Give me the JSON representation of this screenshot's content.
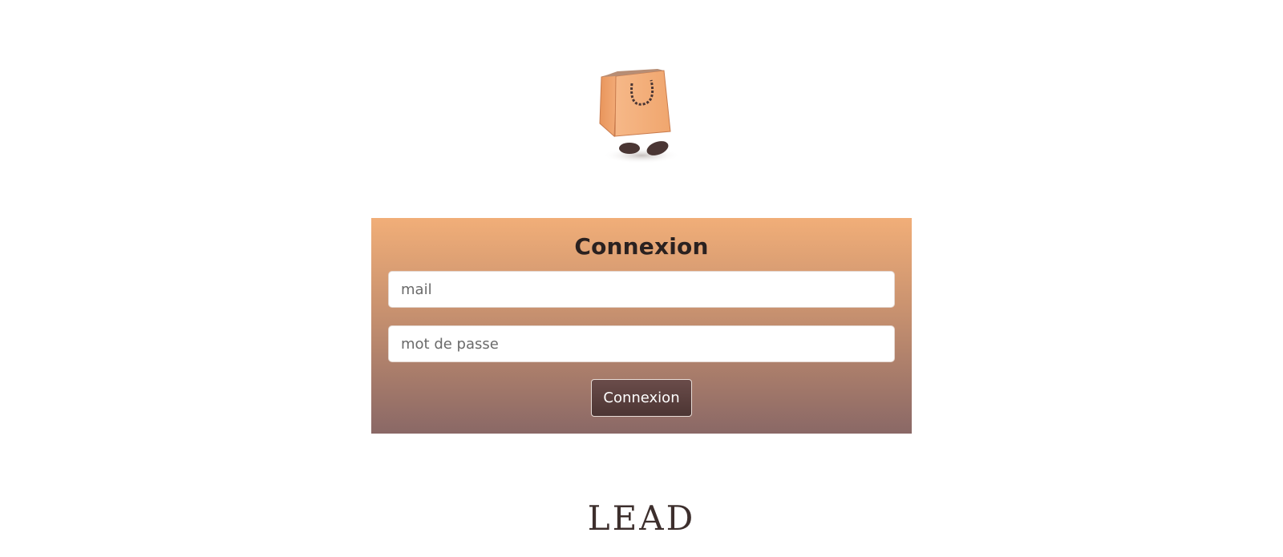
{
  "mascot": {
    "icon": "shopping-bag-mascot-icon"
  },
  "login": {
    "title": "Connexion",
    "email_placeholder": "mail",
    "password_placeholder": "mot de passe",
    "submit_label": "Connexion"
  },
  "brand": {
    "logo_text": "LEAD"
  },
  "colors": {
    "card_top": "#f1ae78",
    "card_bottom": "#8a6866",
    "button": "#5a403e",
    "logo": "#3d2f2d"
  }
}
